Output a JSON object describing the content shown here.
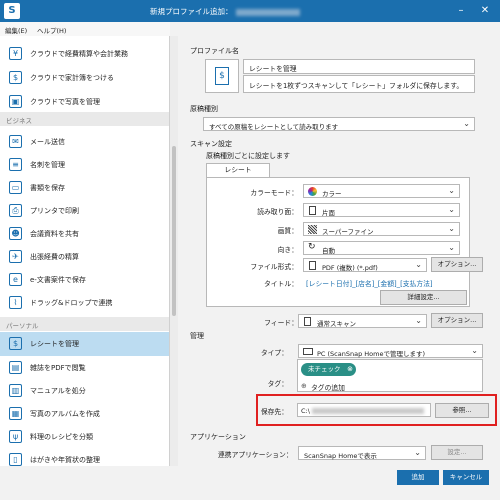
{
  "window": {
    "title": "新規プロファイル追加："
  },
  "menu": {
    "edit": "編集(E)",
    "help": "ヘルプ(H)"
  },
  "sidebar": {
    "items_top": [
      {
        "label": "クラウドで経費精算や会計業務",
        "icon": "receipt-icon"
      },
      {
        "label": "クラウドで家計簿をつける",
        "icon": "household-ledger-icon"
      },
      {
        "label": "クラウドで写真を管理",
        "icon": "photo-icon"
      }
    ],
    "section_business": "ビジネス",
    "items_business": [
      {
        "label": "メール送信",
        "icon": "mail-icon"
      },
      {
        "label": "名刺を管理",
        "icon": "business-card-icon"
      },
      {
        "label": "書類を保存",
        "icon": "folder-icon"
      },
      {
        "label": "プリンタで印刷",
        "icon": "printer-icon"
      },
      {
        "label": "会議資料を共有",
        "icon": "people-icon"
      },
      {
        "label": "出張経費の精算",
        "icon": "airplane-icon"
      },
      {
        "label": "e-文書案件で保存",
        "icon": "e-document-icon"
      },
      {
        "label": "ドラッグ&ドロップで連携",
        "icon": "paperclip-icon"
      }
    ],
    "section_personal": "パーソナル",
    "items_personal": [
      {
        "label": "レシートを管理",
        "icon": "receipt-icon"
      },
      {
        "label": "雑誌をPDFで閲覧",
        "icon": "magazine-icon"
      },
      {
        "label": "マニュアルを処分",
        "icon": "manual-icon"
      },
      {
        "label": "写真のアルバムを作成",
        "icon": "album-icon"
      },
      {
        "label": "料理のレシピを分類",
        "icon": "fork-knife-icon"
      },
      {
        "label": "はがきや年賀状の整理",
        "icon": "postcard-icon"
      }
    ]
  },
  "profile": {
    "section_label": "プロファイル名",
    "name": "レシートを管理",
    "description": "レシートを1枚ずつスキャンして「レシート」フォルダに保存します。"
  },
  "doc_type": {
    "label": "原稿種別",
    "value": "すべての原稿をレシートとして読み取ります"
  },
  "scan_settings": {
    "label": "スキャン設定",
    "sub_label": "原稿種別ごとに設定します",
    "tab": "レシート",
    "color_mode": {
      "label": "カラーモード：",
      "value": "カラー"
    },
    "scan_side": {
      "label": "読み取り面：",
      "value": "片面"
    },
    "image_quality": {
      "label": "画質：",
      "value": "スーパーファイン"
    },
    "rotation": {
      "label": "向き：",
      "value": "自動"
    },
    "file_format": {
      "label": "ファイル形式：",
      "value": "PDF (複数) (*.pdf)",
      "options_button": "オプション..."
    },
    "title": {
      "label": "タイトル：",
      "value": "[レシート日付]_[店名]_[金額]_[支払方法]"
    },
    "detail_button": "詳細設定...",
    "feed": {
      "label": "フィード：",
      "value": "通常スキャン",
      "options_button": "オプション..."
    }
  },
  "management": {
    "label": "管理",
    "type": {
      "label": "タイプ：",
      "value": "PC (ScanSnap Homeで管理します)"
    },
    "tags": {
      "label": "タグ：",
      "chip": "未チェック",
      "add": "タグの追加"
    },
    "save_to": {
      "label": "保存先：",
      "prefix": "C:\\",
      "browse_button": "参照..."
    }
  },
  "application": {
    "label": "アプリケーション",
    "linked": {
      "label": "連携アプリケーション：",
      "value": "ScanSnap Homeで表示",
      "settings_button": "設定..."
    }
  },
  "footer": {
    "add": "追加",
    "cancel": "キャンセル"
  }
}
